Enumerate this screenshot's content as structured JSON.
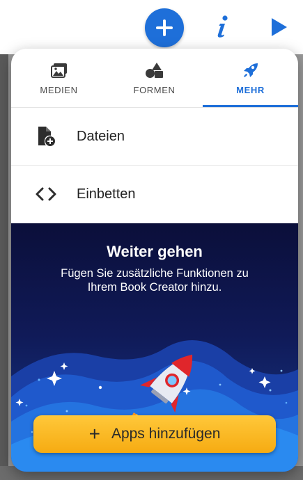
{
  "toolbar": {
    "add_icon": "plus-icon",
    "info_icon": "info-icon",
    "play_icon": "play-icon",
    "accent": "#1e6fd9"
  },
  "tabs": [
    {
      "label": "MEDIEN",
      "icon": "media-icon",
      "active": false
    },
    {
      "label": "FORMEN",
      "icon": "shapes-icon",
      "active": false
    },
    {
      "label": "MEHR",
      "icon": "rocket-icon",
      "active": true
    }
  ],
  "menu": {
    "items": [
      {
        "label": "Dateien",
        "icon": "file-add-icon"
      },
      {
        "label": "Einbetten",
        "icon": "code-icon"
      }
    ]
  },
  "promo": {
    "title": "Weiter gehen",
    "description": "Fügen Sie zusätzliche Funktionen zu Ihrem Book Creator hinzu.",
    "button_label": "Apps hinzufügen",
    "button_icon": "plus-icon",
    "button_color": "#f6ab12"
  }
}
